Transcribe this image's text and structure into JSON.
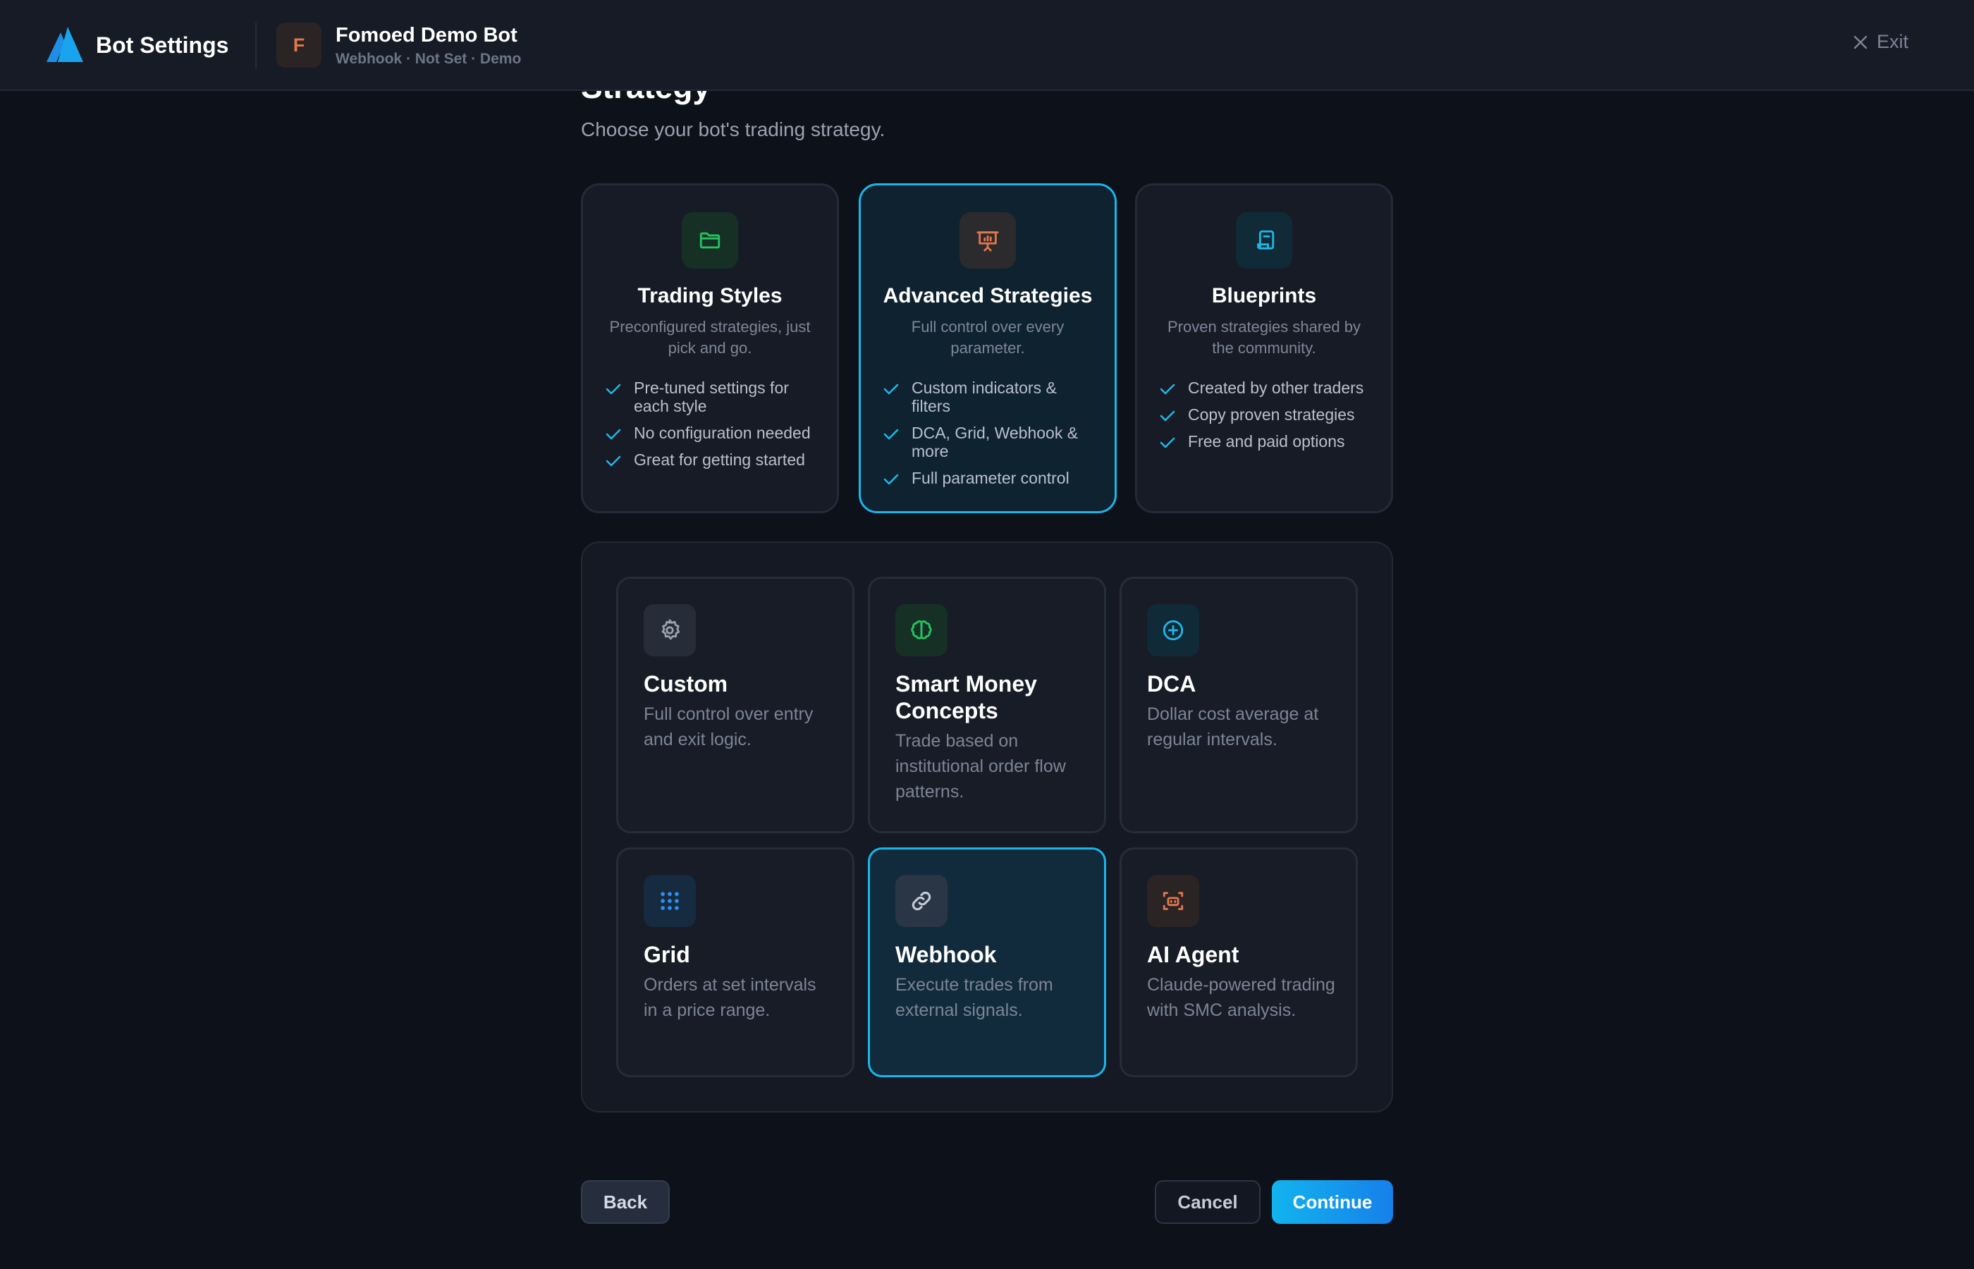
{
  "header": {
    "title": "Bot Settings",
    "bot_initial": "F",
    "bot_name": "Fomoed Demo Bot",
    "bot_meta": "Webhook · Not Set · Demo",
    "exit_label": "Exit"
  },
  "page": {
    "title": "Strategy",
    "subtitle": "Choose your bot's trading strategy."
  },
  "modes": [
    {
      "title": "Trading Styles",
      "desc": "Preconfigured strategies, just pick and go.",
      "icon": "folder-icon",
      "features": [
        "Pre-tuned settings for each style",
        "No configuration needed",
        "Great for getting started"
      ],
      "selected": false
    },
    {
      "title": "Advanced Strategies",
      "desc": "Full control over every parameter.",
      "icon": "presentation-chart-icon",
      "features": [
        "Custom indicators & filters",
        "DCA, Grid, Webhook & more",
        "Full parameter control"
      ],
      "selected": true
    },
    {
      "title": "Blueprints",
      "desc": "Proven strategies shared by the community.",
      "icon": "scroll-icon",
      "features": [
        "Created by other traders",
        "Copy proven strategies",
        "Free and paid options"
      ],
      "selected": false
    }
  ],
  "strategies": [
    {
      "title": "Custom",
      "desc": "Full control over entry and exit logic.",
      "icon": "gear-icon",
      "selected": false
    },
    {
      "title": "Smart Money Concepts",
      "desc": "Trade based on institutional order flow patterns.",
      "icon": "brain-icon",
      "selected": false
    },
    {
      "title": "DCA",
      "desc": "Dollar cost average at regular intervals.",
      "icon": "plus-circle-icon",
      "selected": false
    },
    {
      "title": "Grid",
      "desc": "Orders at set intervals in a price range.",
      "icon": "grid-dots-icon",
      "selected": false
    },
    {
      "title": "Webhook",
      "desc": "Execute trades from external signals.",
      "icon": "link-icon",
      "selected": true
    },
    {
      "title": "AI Agent",
      "desc": "Claude-powered trading with SMC analysis.",
      "icon": "robot-icon",
      "selected": false
    }
  ],
  "footer": {
    "back_label": "Back",
    "cancel_label": "Cancel",
    "continue_label": "Continue"
  },
  "colors": {
    "accent": "#19b6ea",
    "background": "#0d1119",
    "green": "#22c55e",
    "orange": "#e0774e",
    "cyan": "#1fb6e6"
  }
}
